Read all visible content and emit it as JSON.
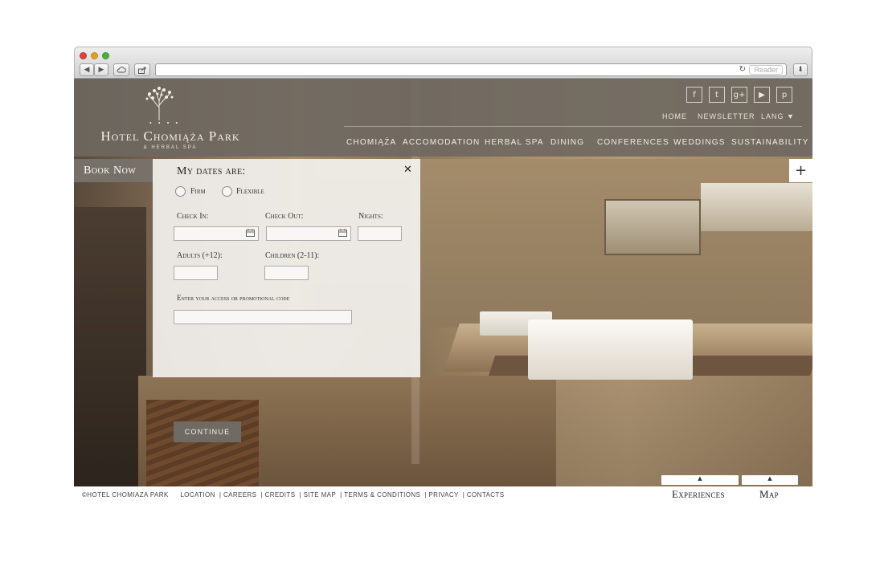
{
  "browser": {
    "nav_back": "◀",
    "nav_forward": "▶",
    "icloud_icon": "cloud-icon",
    "share_icon": "share-icon",
    "url": "",
    "reload": "↻",
    "reader": "Reader",
    "download": "⬇",
    "resize": "⤢"
  },
  "site": {
    "logo_dots": "• • • •",
    "logo_name": "Hotel Chomiąża Park",
    "logo_sub": "& HERBAL SPA",
    "social": [
      "f",
      "t",
      "g+",
      "▶",
      "p"
    ],
    "util_links": [
      "HOME",
      "NEWSLETTER",
      "LANG ▼"
    ],
    "nav": [
      "CHOMIĄŻA",
      "ACCOMODATION",
      "HERBAL SPA",
      "DINING",
      "CONFERENCES",
      "WEDDINGS",
      "SUSTAINABILITY"
    ],
    "book_now": "Book Now",
    "plus": "+"
  },
  "booking": {
    "title": "My dates are:",
    "close": "✕",
    "radio_options": [
      "Firm",
      "Flexible"
    ],
    "check_in_label": "Check In:",
    "check_out_label": "Check Out:",
    "nights_label": "Nights:",
    "adults_label": "Adults (+12):",
    "children_label": "Children (2-11):",
    "promo_label": "Enter your access or promotional code",
    "calendar_icon": "📅",
    "continue": "CONTINUE"
  },
  "footer": {
    "copyright": "©HOTEL CHOMIAZA PARK",
    "links": [
      "LOCATION",
      "CAREERS",
      "CREDITS",
      "SITE MAP",
      "TERMS & CONDITIONS",
      "PRIVACY",
      "CONTACTS"
    ],
    "tabs": [
      "Experiences",
      "Map"
    ],
    "tab_arrow": "▲"
  }
}
